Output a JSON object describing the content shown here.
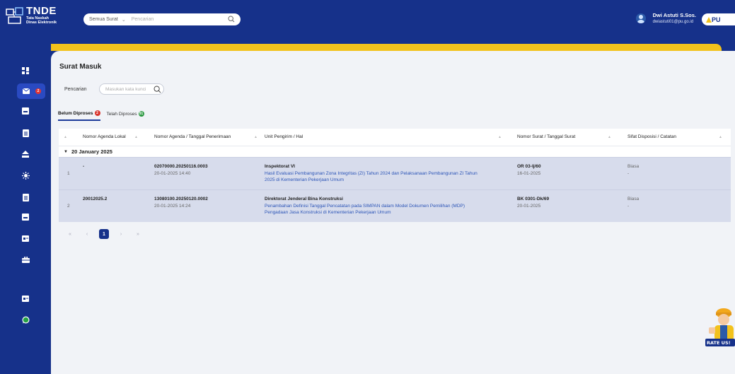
{
  "header": {
    "logo_title": "TNDE",
    "logo_sub1": "Tata Naskah",
    "logo_sub2": "Dinas Elektronik",
    "search_type": "Semua Surat",
    "search_placeholder": "Pencarian",
    "user_name": "Dwi Astuti S.Sos.",
    "user_email": "dwiastuti01@pu.go.id",
    "badge_text": "PU"
  },
  "sidebar": {
    "inbox_badge": "2"
  },
  "page": {
    "title": "Surat Masuk",
    "search_label": "Pencarian",
    "keyword_placeholder": "Masukan kata kunci"
  },
  "tabs": [
    {
      "label": "Belum Diproses",
      "count": "2",
      "color": "#d9342b"
    },
    {
      "label": "Telah Diproses",
      "count": "91",
      "color": "#2e9a43"
    }
  ],
  "table": {
    "headers": [
      "Nomor Agenda Lokal",
      "Nomor Agenda / Tanggal Penerimaan",
      "Unit Pengirim / Hal",
      "Nomor Surat / Tanggal Surat",
      "Sifat Disposisi / Catatan"
    ],
    "group": "20 January 2025",
    "rows": [
      {
        "no": "1",
        "agenda_lokal": "-",
        "agenda": "02070000.20250116.0003",
        "tgl_terima": "20-01-2025 14:40",
        "unit": "Inspektorat VI",
        "hal1": "Hasil Evaluasi Pembangunan Zona Integritas (ZI) Tahun 2024 dan Pelaksanaan Pembangunan ZI Tahun",
        "hal2": "2025 di Kementerian Pekerjaan Umum",
        "nomor_surat": "OR 03-Ij/60",
        "tgl_surat": "16-01-2025",
        "sifat": "Biasa",
        "catatan": "-"
      },
      {
        "no": "2",
        "agenda_lokal": "20012025.2",
        "agenda": "13080100.20250120.0002",
        "tgl_terima": "20-01-2025 14:24",
        "unit": "Direktorat Jenderal Bina Konstruksi",
        "hal1": "Penambahan Definisi Tanggal Pencatatan pada SIMPAN dalam Model Dokumen Pemilihan (MDP)",
        "hal2": "Pengadaan Jasa Konstruksi di Kementerian Pekerjaan Umum",
        "nomor_surat": "BK 0301-Dk/69",
        "tgl_surat": "20-01-2025",
        "sifat": "Biasa",
        "catatan": "-"
      }
    ]
  },
  "pager": {
    "first": "«",
    "prev": "‹",
    "current": "1",
    "next": "›",
    "last": "»"
  },
  "rate": {
    "label": "RATE US!"
  }
}
